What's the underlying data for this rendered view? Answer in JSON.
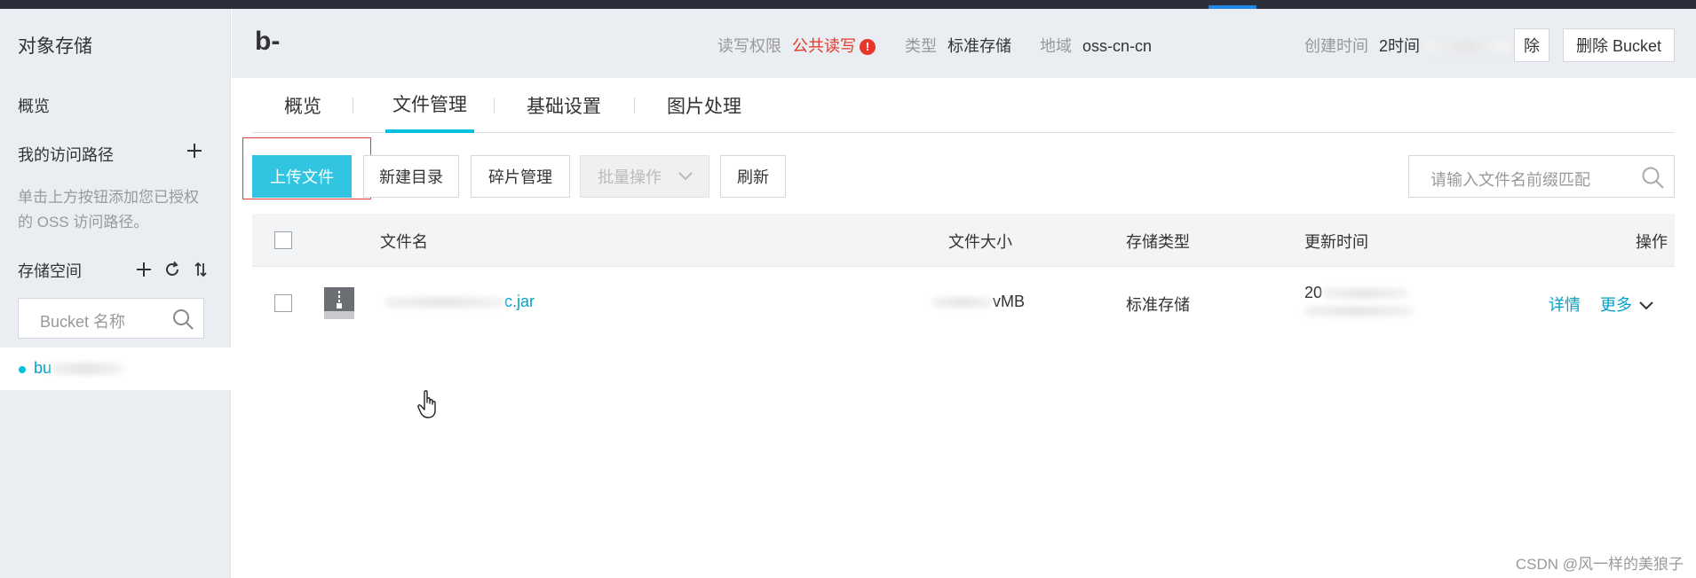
{
  "sidebar": {
    "title": "对象存储",
    "overview": "概览",
    "access_paths": "我的访问路径",
    "hint": "单击上方按钮添加您已授权的 OSS 访问路径。",
    "storage_space": "存储空间",
    "search_placeholder": "Bucket 名称",
    "bucket_name_prefix": "bu"
  },
  "header": {
    "bucket_title": "b-",
    "read_write_label": "读写权限",
    "read_write_value": "公共读写",
    "warn_symbol": "!",
    "type_label": "类型",
    "type_value": "标准存储",
    "region_label": "地域",
    "region_value": "oss-cn-cn",
    "created_label": "创建时间",
    "created_value": "2时间",
    "partial_button": "除",
    "delete_bucket": "删除 Bucket"
  },
  "tabs": [
    "概览",
    "文件管理",
    "基础设置",
    "图片处理"
  ],
  "active_tab": 1,
  "toolbar": {
    "upload": "上传文件",
    "new_dir": "新建目录",
    "fragments": "碎片管理",
    "batch": "批量操作",
    "refresh": "刷新",
    "search_placeholder": "请输入文件名前缀匹配"
  },
  "table": {
    "headers": [
      "文件名",
      "文件大小",
      "存储类型",
      "更新时间",
      "操作"
    ],
    "rows": [
      {
        "name_suffix": "c.jar",
        "size_suffix": "vMB",
        "storage": "标准存储",
        "updated_prefix": "20",
        "detail": "详情",
        "more": "更多"
      }
    ]
  },
  "watermark": "CSDN @风一样的美狼子",
  "colors": {
    "primary": "#32c5e1",
    "link": "#00a2ca",
    "warning": "#e5382a",
    "sidebar_bg": "#eaedf1"
  }
}
